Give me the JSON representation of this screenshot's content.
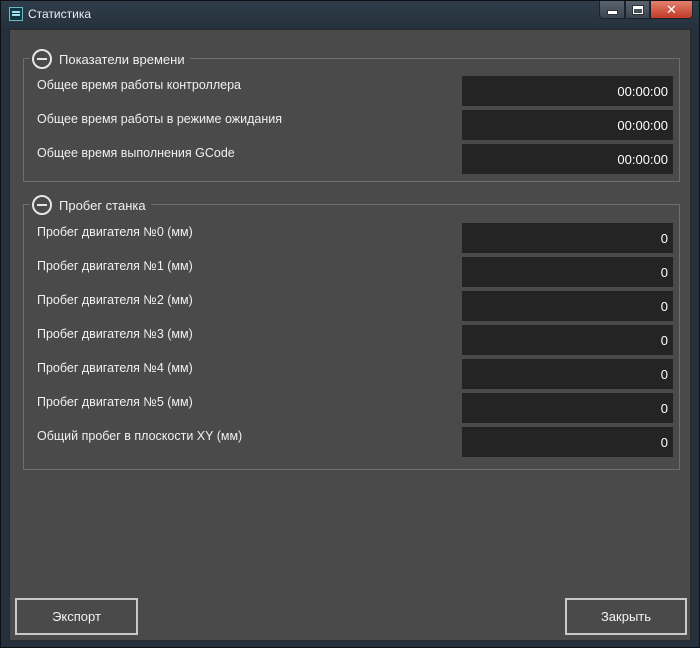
{
  "window": {
    "title": "Статистика",
    "close_glyph": "✕"
  },
  "time_group": {
    "title": "Показатели времени",
    "rows": [
      {
        "label": "Общее время работы контроллера",
        "value": "00:00:00"
      },
      {
        "label": "Общее время работы в режиме ожидания",
        "value": "00:00:00"
      },
      {
        "label": "Общее время выполнения GCode",
        "value": "00:00:00"
      }
    ]
  },
  "mileage_group": {
    "title": "Пробег станка",
    "rows": [
      {
        "label": "Пробег двигателя №0 (мм)",
        "value": "0"
      },
      {
        "label": "Пробег двигателя №1 (мм)",
        "value": "0"
      },
      {
        "label": "Пробег двигателя №2 (мм)",
        "value": "0"
      },
      {
        "label": "Пробег двигателя №3 (мм)",
        "value": "0"
      },
      {
        "label": "Пробег двигателя №4 (мм)",
        "value": "0"
      },
      {
        "label": "Пробег двигателя №5 (мм)",
        "value": "0"
      },
      {
        "label": "Общий пробег в плоскости XY (мм)",
        "value": "0"
      }
    ]
  },
  "buttons": {
    "export_label": "Экспорт",
    "close_label": "Закрыть"
  }
}
